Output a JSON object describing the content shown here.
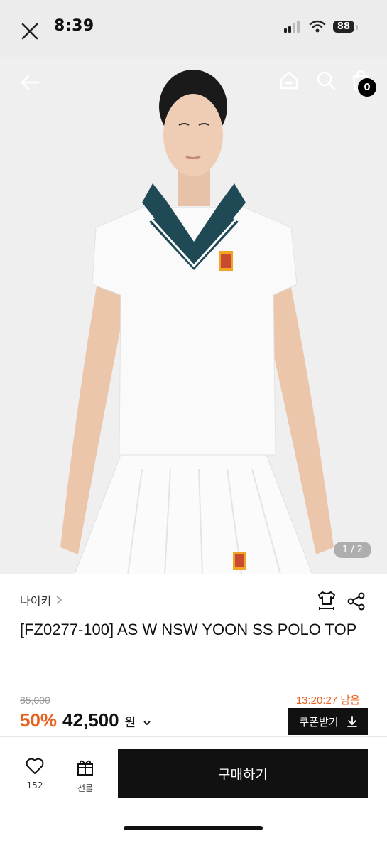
{
  "status_bar": {
    "time": "8:39",
    "battery": "88",
    "icons": [
      "close-icon",
      "signal-icon",
      "wifi-icon",
      "battery-icon"
    ]
  },
  "header": {
    "icons": [
      "back-arrow-icon",
      "home-icon",
      "search-icon",
      "shopping-bag-icon"
    ],
    "cart_count": "0"
  },
  "gallery": {
    "page_indicator": "1 / 2"
  },
  "product": {
    "brand": "나이키",
    "title": "[FZ0277-100] AS W NSW YOON SS POLO TOP",
    "original_price": "85,000",
    "discount": "50%",
    "price": "42,500",
    "currency": "원",
    "countdown": "13:20:27 남음",
    "coupon_label": "쿠폰받기"
  },
  "bottom_bar": {
    "like_count": "152",
    "gift_label": "선물",
    "buy_label": "구매하기"
  },
  "colors": {
    "accent": "#e8611e",
    "button_bg": "#111111",
    "collar": "#1f4a55"
  }
}
